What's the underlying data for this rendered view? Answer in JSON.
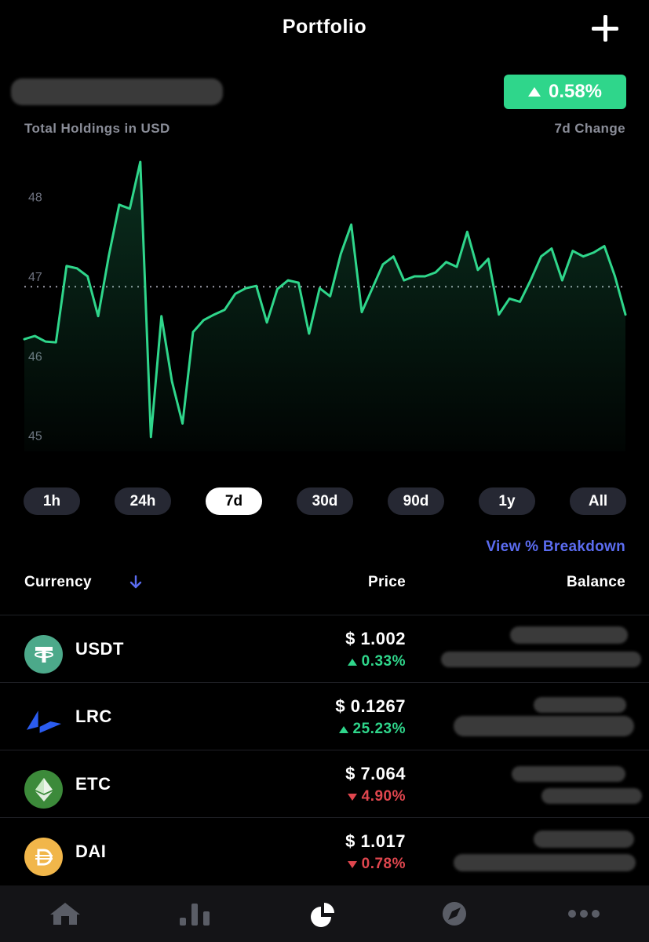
{
  "header": {
    "title": "Portfolio"
  },
  "summary": {
    "holdings_label": "Total Holdings in USD",
    "change_value": "0.58%",
    "change_label": "7d Change"
  },
  "chart_data": {
    "type": "area",
    "y_ticks": [
      "48",
      "47",
      "46",
      "45"
    ],
    "ylim": [
      44.8,
      48.5
    ],
    "reference_value": 46.87,
    "line_color": "#2fd68b",
    "values": [
      46.21,
      46.25,
      46.18,
      46.17,
      47.13,
      47.1,
      47.0,
      46.5,
      47.25,
      47.9,
      47.85,
      48.44,
      44.98,
      46.5,
      45.68,
      45.15,
      46.3,
      46.45,
      46.52,
      46.58,
      46.78,
      46.85,
      46.88,
      46.42,
      46.84,
      46.95,
      46.92,
      46.28,
      46.85,
      46.75,
      47.28,
      47.65,
      46.55,
      46.85,
      47.15,
      47.25,
      46.95,
      47.0,
      47.0,
      47.05,
      47.18,
      47.12,
      47.56,
      47.08,
      47.22,
      46.52,
      46.72,
      46.68,
      46.95,
      47.25,
      47.35,
      46.95,
      47.32,
      47.25,
      47.3,
      47.38,
      47.0,
      46.52
    ]
  },
  "ranges": [
    {
      "label": "1h",
      "active": false
    },
    {
      "label": "24h",
      "active": false
    },
    {
      "label": "7d",
      "active": true
    },
    {
      "label": "30d",
      "active": false
    },
    {
      "label": "90d",
      "active": false
    },
    {
      "label": "1y",
      "active": false
    },
    {
      "label": "All",
      "active": false
    }
  ],
  "breakdown_link": "View % Breakdown",
  "table": {
    "headers": {
      "currency": "Currency",
      "price": "Price",
      "balance": "Balance"
    },
    "rows": [
      {
        "symbol": "USDT",
        "price": "$ 1.002",
        "change": "0.33%",
        "direction": "up",
        "icon": "tether-icon",
        "icon_color": "#4ca98a"
      },
      {
        "symbol": "LRC",
        "price": "$ 0.1267",
        "change": "25.23%",
        "direction": "up",
        "icon": "loopring-icon",
        "icon_color": "#2b5cf0"
      },
      {
        "symbol": "ETC",
        "price": "$ 7.064",
        "change": "4.90%",
        "direction": "down",
        "icon": "ethereum-classic-icon",
        "icon_color": "#3c8a3a"
      },
      {
        "symbol": "DAI",
        "price": "$ 1.017",
        "change": "0.78%",
        "direction": "down",
        "icon": "dai-icon",
        "icon_color": "#f1b64a"
      }
    ]
  },
  "tabbar": {
    "items": [
      "home-icon",
      "markets-icon",
      "portfolio-icon",
      "explore-icon",
      "more-icon"
    ],
    "active": "portfolio-icon"
  }
}
